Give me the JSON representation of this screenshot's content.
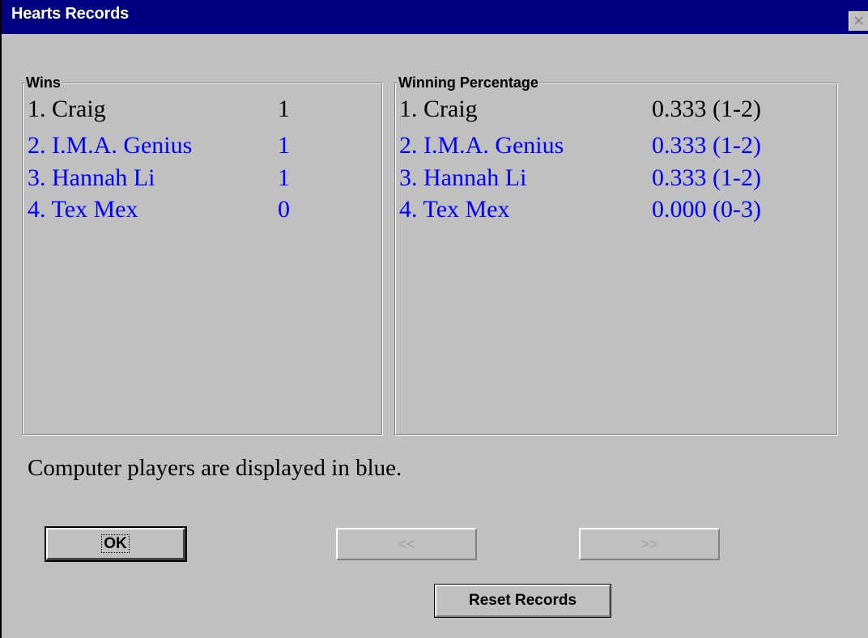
{
  "window": {
    "title": "Hearts Records",
    "close_label": "×"
  },
  "wins": {
    "label": "Wins",
    "rows": [
      {
        "name": "1. Craig",
        "value": "1",
        "type": "human"
      },
      {
        "name": "2. I.M.A. Genius",
        "value": "1",
        "type": "computer"
      },
      {
        "name": "3. Hannah Li",
        "value": "1",
        "type": "computer"
      },
      {
        "name": "4. Tex Mex",
        "value": "0",
        "type": "computer"
      }
    ]
  },
  "percentage": {
    "label": "Winning Percentage",
    "rows": [
      {
        "name": "1. Craig",
        "value": "0.333 (1-2)",
        "type": "human"
      },
      {
        "name": "2. I.M.A. Genius",
        "value": "0.333 (1-2)",
        "type": "computer"
      },
      {
        "name": "3. Hannah Li",
        "value": "0.333 (1-2)",
        "type": "computer"
      },
      {
        "name": "4. Tex Mex",
        "value": "0.000 (0-3)",
        "type": "computer"
      }
    ]
  },
  "note": "Computer players are displayed in blue.",
  "buttons": {
    "ok": "OK",
    "prev": "<<",
    "next": ">>",
    "reset": "Reset Records"
  },
  "colors": {
    "title_bar": "#000080",
    "computer_player": "#0000ff",
    "human_player": "#000000",
    "face": "#c0c0c0"
  }
}
